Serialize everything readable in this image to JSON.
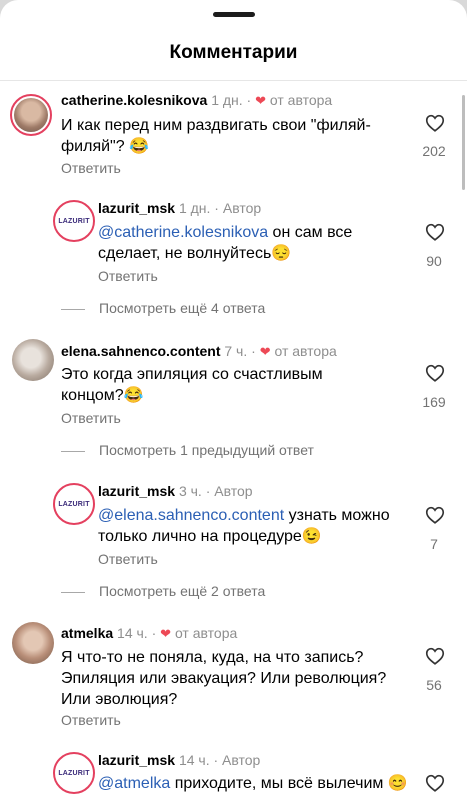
{
  "header": {
    "title": "Комментарии"
  },
  "comments": [
    {
      "user": "catherine.kolesnikova",
      "time": "1 дн.",
      "badge": "от автора",
      "text": "И как перед ним раздвигать свои \"филяй-филяй\"? 😂",
      "reply_label": "Ответить",
      "likes": "202"
    },
    {
      "user": "lazurit_msk",
      "time": "1 дн.",
      "badge": "Автор",
      "mention": "@catherine.kolesnikova",
      "text": " он сам все сделает, не волнуйтесь😔",
      "reply_label": "Ответить",
      "likes": "90",
      "logo_text": "LAZURIT"
    },
    {
      "more": "Посмотреть ещё 4 ответа"
    },
    {
      "user": "elena.sahnenco.content",
      "time": "7 ч.",
      "badge": "от автора",
      "text": "Это когда эпиляция со счастливым концом?😂",
      "reply_label": "Ответить",
      "likes": "169"
    },
    {
      "more": "Посмотреть 1 предыдущий ответ"
    },
    {
      "user": "lazurit_msk",
      "time": "3 ч.",
      "badge": "Автор",
      "mention": "@elena.sahnenco.content",
      "text": " узнать можно только лично на процедуре😉",
      "reply_label": "Ответить",
      "likes": "7",
      "logo_text": "LAZURIT"
    },
    {
      "more": "Посмотреть ещё 2 ответа"
    },
    {
      "user": "atmelka",
      "time": "14 ч.",
      "badge": "от автора",
      "text": "Я что-то не поняла, куда, на что запись? Эпиляция или эвакуация? Или революция? Или эволюция?",
      "reply_label": "Ответить",
      "likes": "56"
    },
    {
      "user": "lazurit_msk",
      "time": "14 ч.",
      "badge": "Автор",
      "mention": "@atmelka",
      "text": " приходите, мы всё вылечим 😊",
      "logo_text": "LAZURIT"
    }
  ],
  "colors": {
    "heart": "#ed4956",
    "mention": "#2b5fb4",
    "story_ring": "#e4405f"
  },
  "icons": {
    "like": "heart-outline-icon",
    "author_like": "heart-filled-icon"
  }
}
